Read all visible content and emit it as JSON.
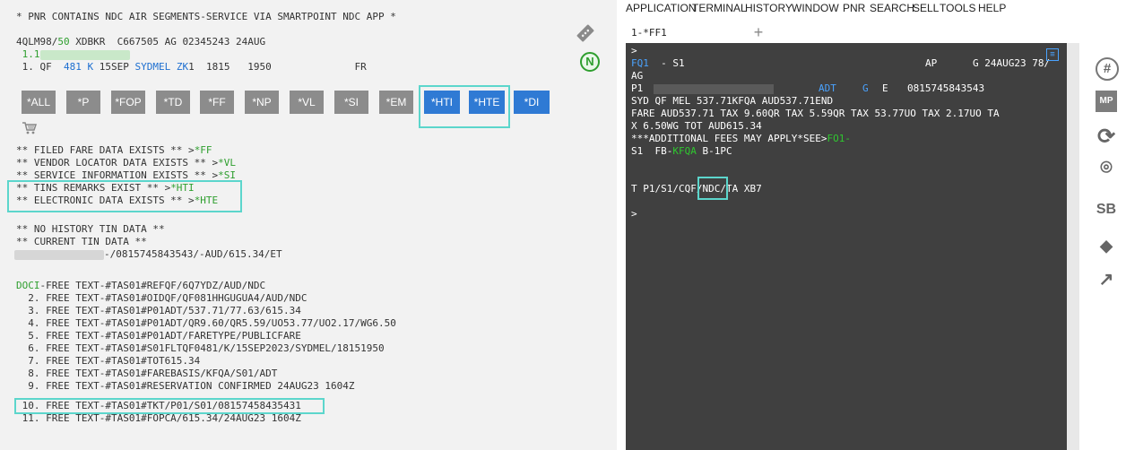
{
  "left": {
    "header_line": "* PNR CONTAINS NDC AIR SEGMENTS-SERVICE VIA SMARTPOINT NDC APP *",
    "record_line": {
      "pre": "4QLM98/",
      "num": "50",
      "post": " XDBKR  C667505 AG 02345243 24AUG"
    },
    "passenger_line": " 1.1",
    "segment_line": {
      "pre": " 1. QF  ",
      "flight": "481 K",
      "mid": " 15SEP ",
      "route": "SYDMEL ZK",
      "post": "1  1815   1950              FR"
    },
    "buttons": [
      "*ALL",
      "*P",
      "*FOP",
      "*TD",
      "*FF",
      "*NP",
      "*VL",
      "*SI",
      "*EM",
      "*HTI",
      "*HTE",
      "*DI"
    ],
    "active_buttons": [
      "*HTI",
      "*HTE",
      "*DI"
    ],
    "exists_lines": [
      {
        "text": "** FILED FARE DATA EXISTS ** >",
        "link": "*FF"
      },
      {
        "text": "** VENDOR LOCATOR DATA EXISTS ** >",
        "link": "*VL"
      },
      {
        "text": "** SERVICE INFORMATION EXISTS ** >",
        "link": "*SI"
      },
      {
        "text": "** TINS REMARKS EXIST ** >",
        "link": "*HTI"
      },
      {
        "text": "** ELECTRONIC DATA EXISTS ** >",
        "link": "*HTE"
      }
    ],
    "history_lines": [
      "** NO HISTORY TIN DATA **",
      "** CURRENT TIN DATA **"
    ],
    "tin_line": "-/0815745843543/-AUD/615.34/ET",
    "doci_label": "DOCI",
    "doci_rest": "-FREE TEXT-#TAS01#REFQF/6Q7YDZ/AUD/NDC",
    "free_text": [
      "  2. FREE TEXT-#TAS01#OIDQF/QF081HHGUGUA4/AUD/NDC",
      "  3. FREE TEXT-#TAS01#P01ADT/537.71/77.63/615.34",
      "  4. FREE TEXT-#TAS01#P01ADT/QR9.60/QR5.59/UO53.77/UO2.17/WG6.50",
      "  5. FREE TEXT-#TAS01#P01ADT/FARETYPE/PUBLICFARE",
      "  6. FREE TEXT-#TAS01#S01FLTQF0481/K/15SEP2023/SYDMEL/18151950",
      "  7. FREE TEXT-#TAS01#TOT615.34",
      "  8. FREE TEXT-#TAS01#FAREBASIS/KFQA/S01/ADT",
      "  9. FREE TEXT-#TAS01#RESERVATION CONFIRMED 24AUG23 1604Z",
      " 10. FREE TEXT-#TAS01#TKT/P01/S01/08157458435431",
      " 11. FREE TEXT-#TAS01#FOPCA/615.34/24AUG23 1604Z"
    ],
    "n_badge": "N"
  },
  "menubar": [
    "APPLICATION",
    "TERMINAL",
    "HISTORY",
    "WINDOW",
    "PNR",
    "SEARCH",
    "SELL",
    "TOOLS",
    "HELP"
  ],
  "tabs": {
    "active": "1-*FF1",
    "plus": "+"
  },
  "terminal": {
    "prompt1": ">",
    "fq_label": "FQ1",
    "fq_rest": "  - S1",
    "fq_right": "AP      G 24AUG23 78/",
    "ag": "AG",
    "p1": "P1",
    "adt": "ADT",
    "g": "G",
    "e": "E",
    "ticket": "0815745843543",
    "fare1": "SYD QF MEL 537.71KFQA AUD537.71END",
    "fare2": "FARE AUD537.71 TAX 9.60QR TAX 5.59QR TAX 53.77UO TAX 2.17UO TA",
    "fare3": "X 6.50WG TOT AUD615.34",
    "fees_pre": "***ADDITIONAL FEES MAY APPLY*SEE>",
    "fees_link": "FO1-",
    "fb_pre": "S1  FB-",
    "fb_code": "KFQA",
    "fb_post": " B-1PC",
    "t_pre": "T P1/S1/CQF/",
    "t_ndc": "NDC",
    "t_post": "/TA XB7",
    "prompt2": ">"
  },
  "side_icons": [
    {
      "name": "hash-icon",
      "glyph": "#"
    },
    {
      "name": "mp-icon",
      "glyph": "MP"
    },
    {
      "name": "refresh-icon",
      "glyph": "⟳"
    },
    {
      "name": "location-pin-icon",
      "glyph": "⌾"
    },
    {
      "name": "sb-icon",
      "glyph": "SB"
    },
    {
      "name": "ticket-icon",
      "glyph": "◆"
    },
    {
      "name": "external-link-icon",
      "glyph": "↗"
    }
  ]
}
